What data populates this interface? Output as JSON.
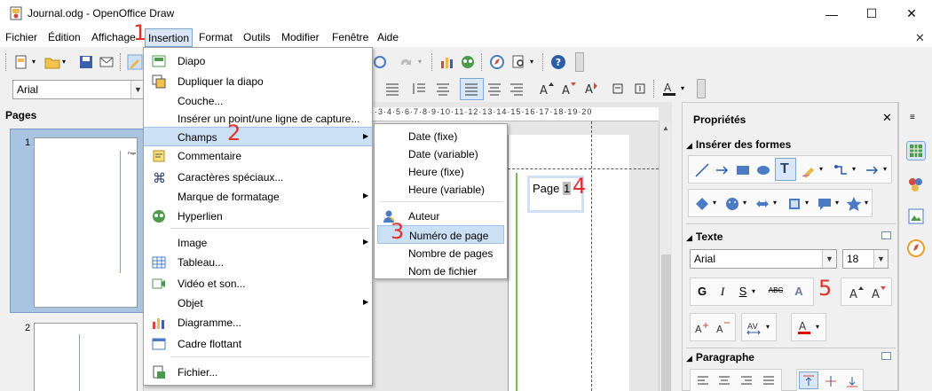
{
  "window": {
    "title": "Journal.odg - OpenOffice Draw",
    "minimize": "—",
    "maximize": "☐",
    "close": "✕"
  },
  "menubar": {
    "items": [
      "Fichier",
      "Édition",
      "Affichage",
      "Insertion",
      "Format",
      "Outils",
      "Modifier",
      "Fenêtre",
      "Aide"
    ],
    "doc_close": "✕"
  },
  "toolbar": {
    "font_name": "Arial"
  },
  "pages_panel": {
    "title": "Pages",
    "page_numbers": [
      "1",
      "2"
    ],
    "thumb_text": "Page"
  },
  "document": {
    "ruler": "·3·4·5·6·7·8·9·10·11·12·13·14·15·16·17·18·19·20",
    "field_label": "Page",
    "field_number": "1"
  },
  "insert_menu": {
    "items": [
      {
        "label": "Diapo",
        "icon": "slide-icon"
      },
      {
        "label": "Dupliquer la diapo",
        "icon": "duplicate-slide-icon"
      },
      {
        "label": "Couche...",
        "icon": ""
      },
      {
        "label": "Insérer un point/une ligne de capture...",
        "icon": ""
      },
      {
        "label": "Champs",
        "icon": "",
        "submenu": true
      },
      {
        "label": "Commentaire",
        "icon": "comment-icon"
      },
      {
        "label": "Caractères spéciaux...",
        "icon": "special-char-icon"
      },
      {
        "label": "Marque de formatage",
        "icon": "",
        "submenu": true
      },
      {
        "label": "Hyperlien",
        "icon": "hyperlink-icon"
      },
      {
        "label": "Image",
        "icon": "",
        "submenu": true
      },
      {
        "label": "Tableau...",
        "icon": "table-icon"
      },
      {
        "label": "Vidéo et son...",
        "icon": "media-icon"
      },
      {
        "label": "Objet",
        "icon": "",
        "submenu": true
      },
      {
        "label": "Diagramme...",
        "icon": "chart-icon"
      },
      {
        "label": "Cadre flottant",
        "icon": "frame-icon"
      },
      {
        "label": "Fichier...",
        "icon": "file-icon"
      }
    ]
  },
  "fields_submenu": {
    "items": [
      "Date (fixe)",
      "Date (variable)",
      "Heure (fixe)",
      "Heure (variable)",
      "Auteur",
      "Numéro de page",
      "Nombre de pages",
      "Nom de fichier"
    ]
  },
  "properties": {
    "title": "Propriétés",
    "close": "✕",
    "sections": [
      "Insérer des formes",
      "Texte",
      "Paragraphe"
    ],
    "font_name": "Arial",
    "font_size": "18"
  },
  "steps": [
    "1",
    "2",
    "3",
    "4",
    "5"
  ],
  "colors": {
    "highlight": "#cbe0f5",
    "step_red": "#e0302a",
    "selection": "#a9c4e0",
    "guide_green": "#7cba5b"
  }
}
